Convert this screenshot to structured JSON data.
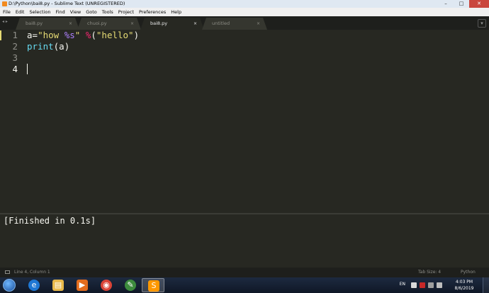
{
  "window": {
    "title": "D:\\Python\\bai8.py - Sublime Text (UNREGISTERED)",
    "minimize_glyph": "–",
    "maximize_glyph": "□",
    "close_glyph": "✕"
  },
  "menu": [
    "File",
    "Edit",
    "Selection",
    "Find",
    "View",
    "Goto",
    "Tools",
    "Project",
    "Preferences",
    "Help"
  ],
  "tabs": [
    {
      "label": "bai8.py",
      "active": false
    },
    {
      "label": "chuoi.py",
      "active": false
    },
    {
      "label": "bai8.py",
      "active": true
    },
    {
      "label": "untitled",
      "active": false
    }
  ],
  "tab_close_glyph": "×",
  "tab_nav_glyph": "◂ ▸",
  "tab_dropdown_glyph": "▾",
  "editor": {
    "line_numbers": [
      "1",
      "2",
      "3",
      "4"
    ],
    "code": {
      "l1_var": "a=",
      "l1_str1": "\"how ",
      "l1_fmt": "%s",
      "l1_str2": "\" ",
      "l1_op": "%",
      "l1_open": "(",
      "l1_str3": "\"hello\"",
      "l1_close": ")",
      "l2_fn": "print",
      "l2_args": "(a)"
    },
    "current_line": 4
  },
  "output": {
    "text": "[Finished in 0.1s]"
  },
  "status": {
    "position": "Line 4, Column 1",
    "tab_size": "Tab Size: 4",
    "syntax": "Python"
  },
  "taskbar": {
    "apps": [
      {
        "name": "internet-explorer",
        "glyph": "e",
        "color": "#1e77d3",
        "active": false
      },
      {
        "name": "file-explorer",
        "glyph": "▤",
        "color": "#e8b84a",
        "active": false
      },
      {
        "name": "media-player",
        "glyph": "▶",
        "color": "#e36c1d",
        "active": false
      },
      {
        "name": "chrome",
        "glyph": "◉",
        "color": "#db4437",
        "active": false
      },
      {
        "name": "green-app",
        "glyph": "✎",
        "color": "#3d8b3d",
        "active": false
      },
      {
        "name": "sublime-text",
        "glyph": "S",
        "color": "#ff9800",
        "active": true
      }
    ],
    "language": "EN",
    "time": "4:03 PM",
    "date": "8/6/2019"
  },
  "colors": {
    "background": "#272822",
    "accent_orange": "#f28a1e"
  }
}
